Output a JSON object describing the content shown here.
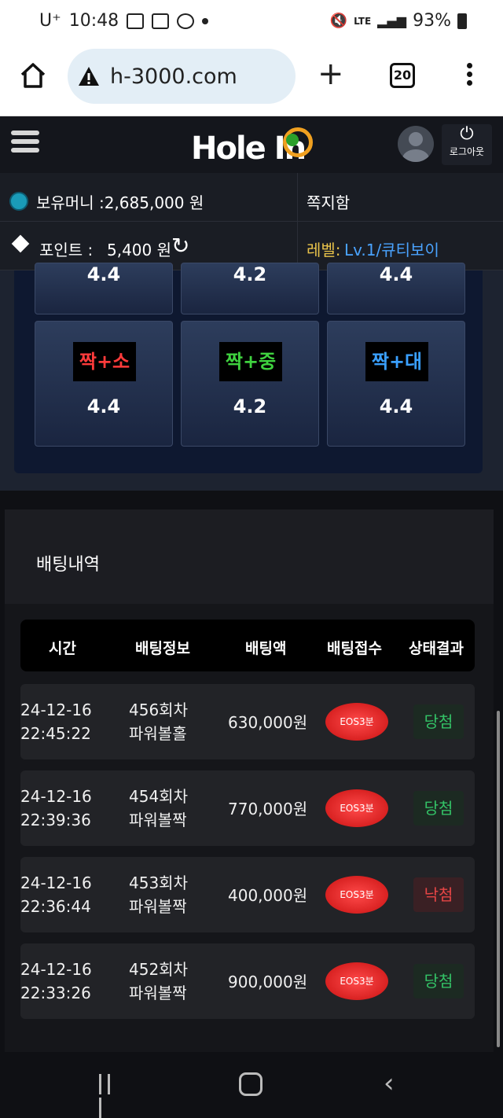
{
  "status_bar": {
    "carrier": "U⁺",
    "time": "10:48",
    "network": "LTE",
    "battery": "93%"
  },
  "browser": {
    "url": "h-3000.com",
    "tab_count": "20"
  },
  "header": {
    "logo_text": "Hole In",
    "logout_label": "로그아웃"
  },
  "info": {
    "money_label": "보유머니 :",
    "money_value": "2,685,000 원",
    "memo_label": "쪽지함",
    "point_label": "포인트 :",
    "point_value": "5,400 원",
    "level_label": "레벨:",
    "level_value": "Lv.1/큐티보이"
  },
  "bet_grid": {
    "top_row_odds": [
      "4.4",
      "4.2",
      "4.4"
    ],
    "cells": [
      {
        "tag": "짝+소",
        "odds": "4.4",
        "color": "#ff3b3b"
      },
      {
        "tag": "짝+중",
        "odds": "4.2",
        "color": "#3fd23f"
      },
      {
        "tag": "짝+대",
        "odds": "4.4",
        "color": "#3aa0ff"
      }
    ]
  },
  "history": {
    "title": "배팅내역",
    "columns": [
      "시간",
      "배팅정보",
      "배팅액",
      "배팅접수",
      "상태결과"
    ],
    "rows": [
      {
        "date": "24-12-16",
        "time": "22:45:22",
        "round": "456회차",
        "pick": "파워볼홀",
        "amount": "630,000원",
        "game": "EOS3분",
        "result": "당첨"
      },
      {
        "date": "24-12-16",
        "time": "22:39:36",
        "round": "454회차",
        "pick": "파워볼짝",
        "amount": "770,000원",
        "game": "EOS3분",
        "result": "당첨"
      },
      {
        "date": "24-12-16",
        "time": "22:36:44",
        "round": "453회차",
        "pick": "파워볼짝",
        "amount": "400,000원",
        "game": "EOS3분",
        "result": "낙첨"
      },
      {
        "date": "24-12-16",
        "time": "22:33:26",
        "round": "452회차",
        "pick": "파워볼짝",
        "amount": "900,000원",
        "game": "EOS3분",
        "result": "당첨"
      }
    ]
  },
  "colors": {
    "win": "#33c266",
    "lose": "#e64545",
    "level_label": "#e8c24a",
    "level_value": "#4aa3ff"
  }
}
